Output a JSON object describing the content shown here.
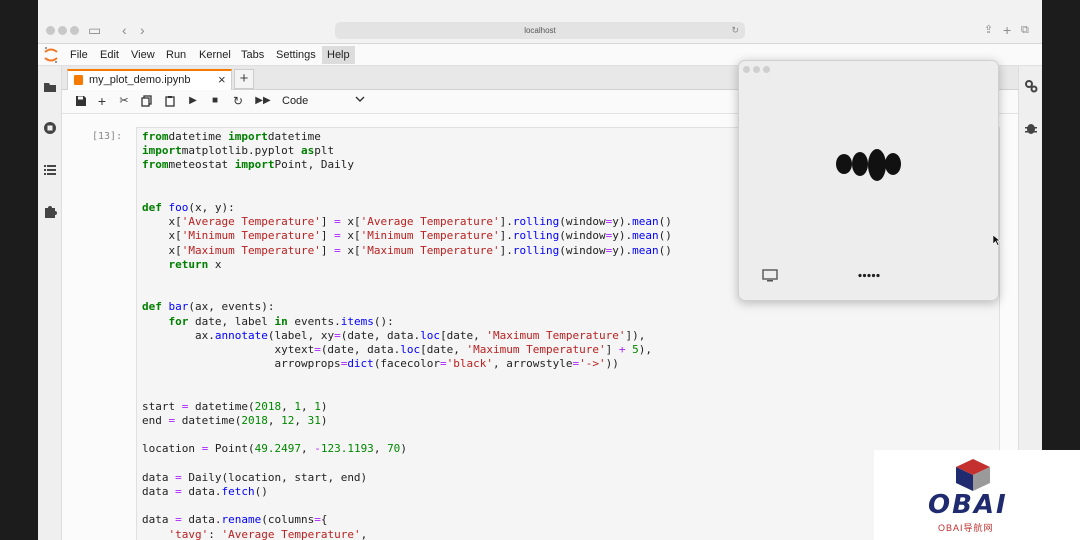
{
  "browser": {
    "url": "localhost"
  },
  "menu": [
    "File",
    "Edit",
    "View",
    "Run",
    "Kernel",
    "Tabs",
    "Settings",
    "Help"
  ],
  "tab": {
    "label": "my_plot_demo.ipynb",
    "close": "×",
    "add": "+"
  },
  "toolbar": {
    "cell_type": "Code",
    "kernel_status": ")"
  },
  "cell": {
    "prompt": "[13]:",
    "lines": [
      [
        [
          "kw",
          "from"
        ],
        [
          "",
          "datetime "
        ],
        [
          "kw",
          "import"
        ],
        [
          "",
          "datetime"
        ]
      ],
      [
        [
          "kw",
          "import"
        ],
        [
          "",
          "matplotlib.pyplot "
        ],
        [
          "kw",
          "as"
        ],
        [
          "",
          "plt"
        ]
      ],
      [
        [
          "kw",
          "from"
        ],
        [
          "",
          "meteostat "
        ],
        [
          "kw",
          "import"
        ],
        [
          "",
          "Point, Daily"
        ]
      ],
      [],
      [],
      [
        [
          "kw",
          "def"
        ],
        [
          "fn",
          " foo"
        ],
        [
          "",
          "(x, y):"
        ]
      ],
      [
        [
          "",
          "    x["
        ],
        [
          "str",
          "'Average Temperature'"
        ],
        [
          "",
          "] "
        ],
        [
          "op",
          "="
        ],
        [
          "",
          " x["
        ],
        [
          "str",
          "'Average Temperature'"
        ],
        [
          "",
          "]."
        ],
        [
          "fn",
          "rolling"
        ],
        [
          "",
          "(window"
        ],
        [
          "op",
          "="
        ],
        [
          "",
          "y)."
        ],
        [
          "fn",
          "mean"
        ],
        [
          "",
          "()"
        ]
      ],
      [
        [
          "",
          "    x["
        ],
        [
          "str",
          "'Minimum Temperature'"
        ],
        [
          "",
          "] "
        ],
        [
          "op",
          "="
        ],
        [
          "",
          " x["
        ],
        [
          "str",
          "'Minimum Temperature'"
        ],
        [
          "",
          "]."
        ],
        [
          "fn",
          "rolling"
        ],
        [
          "",
          "(window"
        ],
        [
          "op",
          "="
        ],
        [
          "",
          "y)."
        ],
        [
          "fn",
          "mean"
        ],
        [
          "",
          "()"
        ]
      ],
      [
        [
          "",
          "    x["
        ],
        [
          "str",
          "'Maximum Temperature'"
        ],
        [
          "",
          "] "
        ],
        [
          "op",
          "="
        ],
        [
          "",
          " x["
        ],
        [
          "str",
          "'Maximum Temperature'"
        ],
        [
          "",
          "]."
        ],
        [
          "fn",
          "rolling"
        ],
        [
          "",
          "(window"
        ],
        [
          "op",
          "="
        ],
        [
          "",
          "y)."
        ],
        [
          "fn",
          "mean"
        ],
        [
          "",
          "()"
        ]
      ],
      [
        [
          "",
          "    "
        ],
        [
          "kw",
          "return"
        ],
        [
          "",
          " x"
        ]
      ],
      [],
      [],
      [
        [
          "kw",
          "def"
        ],
        [
          "fn",
          " bar"
        ],
        [
          "",
          "(ax, events):"
        ]
      ],
      [
        [
          "",
          "    "
        ],
        [
          "kw",
          "for"
        ],
        [
          "",
          " date, label "
        ],
        [
          "kw",
          "in"
        ],
        [
          "",
          " events."
        ],
        [
          "fn",
          "items"
        ],
        [
          "",
          "():"
        ]
      ],
      [
        [
          "",
          "        ax."
        ],
        [
          "fn",
          "annotate"
        ],
        [
          "",
          "(label, xy"
        ],
        [
          "op",
          "="
        ],
        [
          "",
          "(date, data."
        ],
        [
          "fn",
          "loc"
        ],
        [
          "",
          "[date, "
        ],
        [
          "str",
          "'Maximum Temperature'"
        ],
        [
          "",
          "]),"
        ]
      ],
      [
        [
          "",
          "                    xytext"
        ],
        [
          "op",
          "="
        ],
        [
          "",
          "(date, data."
        ],
        [
          "fn",
          "loc"
        ],
        [
          "",
          "[date, "
        ],
        [
          "str",
          "'Maximum Temperature'"
        ],
        [
          "",
          "] "
        ],
        [
          "op",
          "+"
        ],
        [
          "",
          " "
        ],
        [
          "num",
          "5"
        ],
        [
          "",
          "),"
        ]
      ],
      [
        [
          "",
          "                    arrowprops"
        ],
        [
          "op",
          "="
        ],
        [
          "fn",
          "dict"
        ],
        [
          "",
          "(facecolor"
        ],
        [
          "op",
          "="
        ],
        [
          "str",
          "'black'"
        ],
        [
          "",
          ", arrowstyle"
        ],
        [
          "op",
          "="
        ],
        [
          "str",
          "'->'"
        ],
        [
          "",
          "))"
        ]
      ],
      [],
      [],
      [
        [
          "",
          "start "
        ],
        [
          "op",
          "="
        ],
        [
          "",
          " datetime("
        ],
        [
          "num",
          "2018"
        ],
        [
          "",
          ", "
        ],
        [
          "num",
          "1"
        ],
        [
          "",
          ", "
        ],
        [
          "num",
          "1"
        ],
        [
          "",
          ")"
        ]
      ],
      [
        [
          "",
          "end "
        ],
        [
          "op",
          "="
        ],
        [
          "",
          " datetime("
        ],
        [
          "num",
          "2018"
        ],
        [
          "",
          ", "
        ],
        [
          "num",
          "12"
        ],
        [
          "",
          ", "
        ],
        [
          "num",
          "31"
        ],
        [
          "",
          ")"
        ]
      ],
      [],
      [
        [
          "",
          "location "
        ],
        [
          "op",
          "="
        ],
        [
          "",
          " Point("
        ],
        [
          "num",
          "49.2497"
        ],
        [
          "",
          ", "
        ],
        [
          "op",
          "-"
        ],
        [
          "num",
          "123.1193"
        ],
        [
          "",
          ", "
        ],
        [
          "num",
          "70"
        ],
        [
          "",
          ")"
        ]
      ],
      [],
      [
        [
          "",
          "data "
        ],
        [
          "op",
          "="
        ],
        [
          "",
          " Daily(location, start, end)"
        ]
      ],
      [
        [
          "",
          "data "
        ],
        [
          "op",
          "="
        ],
        [
          "",
          " data."
        ],
        [
          "fn",
          "fetch"
        ],
        [
          "",
          "()"
        ]
      ],
      [],
      [
        [
          "",
          "data "
        ],
        [
          "op",
          "="
        ],
        [
          "",
          " data."
        ],
        [
          "fn",
          "rename"
        ],
        [
          "",
          "(columns"
        ],
        [
          "op",
          "="
        ],
        [
          "",
          "{"
        ]
      ],
      [
        [
          "",
          "    "
        ],
        [
          "str",
          "'tavg'"
        ],
        [
          "",
          ": "
        ],
        [
          "str",
          "'Average Temperature'"
        ],
        [
          "",
          ","
        ]
      ]
    ]
  },
  "watermark": {
    "text": "OBAI",
    "sub": "OBAI导航网"
  }
}
